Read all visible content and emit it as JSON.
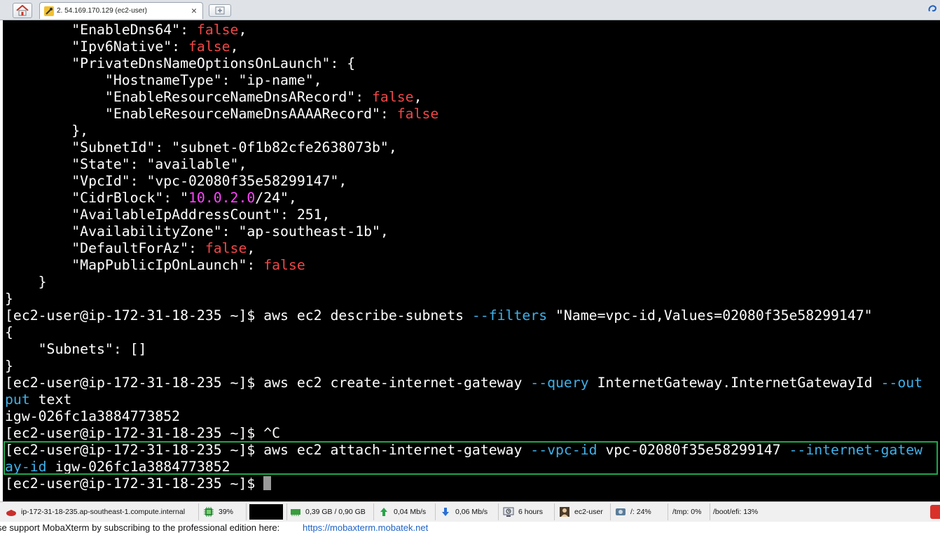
{
  "tab": {
    "title": "2. 54.169.170.129 (ec2-user)",
    "close": "×"
  },
  "terminal": {
    "lines": [
      [
        {
          "t": "        \"EnableDns64\": ",
          "c": "w"
        },
        {
          "t": "false",
          "c": "r"
        },
        {
          "t": ",",
          "c": "w"
        }
      ],
      [
        {
          "t": "        \"Ipv6Native\": ",
          "c": "w"
        },
        {
          "t": "false",
          "c": "r"
        },
        {
          "t": ",",
          "c": "w"
        }
      ],
      [
        {
          "t": "        \"PrivateDnsNameOptionsOnLaunch\": {",
          "c": "w"
        }
      ],
      [
        {
          "t": "            \"HostnameType\": \"ip-name\",",
          "c": "w"
        }
      ],
      [
        {
          "t": "            \"EnableResourceNameDnsARecord\": ",
          "c": "w"
        },
        {
          "t": "false",
          "c": "r"
        },
        {
          "t": ",",
          "c": "w"
        }
      ],
      [
        {
          "t": "            \"EnableResourceNameDnsAAAARecord\": ",
          "c": "w"
        },
        {
          "t": "false",
          "c": "r"
        }
      ],
      [
        {
          "t": "        },",
          "c": "w"
        }
      ],
      [
        {
          "t": "        \"SubnetId\": \"subnet-0f1b82cfe2638073b\",",
          "c": "w"
        }
      ],
      [
        {
          "t": "        \"State\": \"available\",",
          "c": "w"
        }
      ],
      [
        {
          "t": "        \"VpcId\": \"vpc-02080f35e58299147\",",
          "c": "w"
        }
      ],
      [
        {
          "t": "        \"CidrBlock\": \"",
          "c": "w"
        },
        {
          "t": "10.0.2.0",
          "c": "m"
        },
        {
          "t": "/24\",",
          "c": "w"
        }
      ],
      [
        {
          "t": "        \"AvailableIpAddressCount\": 251,",
          "c": "w"
        }
      ],
      [
        {
          "t": "        \"AvailabilityZone\": \"ap-southeast-1b\",",
          "c": "w"
        }
      ],
      [
        {
          "t": "        \"DefaultForAz\": ",
          "c": "w"
        },
        {
          "t": "false",
          "c": "r"
        },
        {
          "t": ",",
          "c": "w"
        }
      ],
      [
        {
          "t": "        \"MapPublicIpOnLaunch\": ",
          "c": "w"
        },
        {
          "t": "false",
          "c": "r"
        }
      ],
      [
        {
          "t": "    }",
          "c": "w"
        }
      ],
      [
        {
          "t": "}",
          "c": "w"
        }
      ],
      [
        {
          "t": "[ec2-user@ip-172-31-18-235 ~]$ aws ec2 describe-subnets ",
          "c": "w"
        },
        {
          "t": "--filters",
          "c": "c"
        },
        {
          "t": " \"Name=vpc-id,Values=02080f35e58299147\"",
          "c": "w"
        }
      ],
      [
        {
          "t": "{",
          "c": "w"
        }
      ],
      [
        {
          "t": "    \"Subnets\": []",
          "c": "w"
        }
      ],
      [
        {
          "t": "}",
          "c": "w"
        }
      ],
      [
        {
          "t": "[ec2-user@ip-172-31-18-235 ~]$ aws ec2 create-internet-gateway ",
          "c": "w"
        },
        {
          "t": "--query",
          "c": "c"
        },
        {
          "t": " InternetGateway.InternetGatewayId ",
          "c": "w"
        },
        {
          "t": "--out",
          "c": "c"
        }
      ],
      [
        {
          "t": "put",
          "c": "c"
        },
        {
          "t": " text",
          "c": "w"
        }
      ],
      [
        {
          "t": "igw-026fc1a3884773852",
          "c": "w"
        }
      ],
      [
        {
          "t": "[ec2-user@ip-172-31-18-235 ~]$ ^C",
          "c": "w"
        }
      ],
      [
        {
          "t": "[ec2-user@ip-172-31-18-235 ~]$ aws ec2 attach-internet-gateway ",
          "c": "w"
        },
        {
          "t": "--vpc-id",
          "c": "c"
        },
        {
          "t": " vpc-02080f35e58299147 ",
          "c": "w"
        },
        {
          "t": "--internet-gatew",
          "c": "c"
        }
      ],
      [
        {
          "t": "ay-id",
          "c": "c"
        },
        {
          "t": " igw-026fc1a3884773852",
          "c": "w"
        }
      ],
      [
        {
          "t": "[ec2-user@ip-172-31-18-235 ~]$ ",
          "c": "w"
        }
      ]
    ]
  },
  "status": {
    "host": "ip-172-31-18-235.ap-southeast-1.compute.internal",
    "cpu": "39%",
    "memory": "0,39 GB / 0,90 GB",
    "upload": "0,04 Mb/s",
    "download": "0,06 Mb/s",
    "uptime": "6 hours",
    "user": "ec2-user",
    "disk_root": "/: 24%",
    "disk_tmp": "/tmp: 0%",
    "disk_efi": "/boot/efi: 13%"
  },
  "footer": {
    "message": "se support MobaXterm by subscribing to the professional edition here:",
    "link": "https://mobaxterm.mobatek.net"
  },
  "colors": {
    "red": "#f04747",
    "magenta": "#ff45ff",
    "cyan": "#3fb1ea",
    "highlight": "#1fa64a"
  }
}
